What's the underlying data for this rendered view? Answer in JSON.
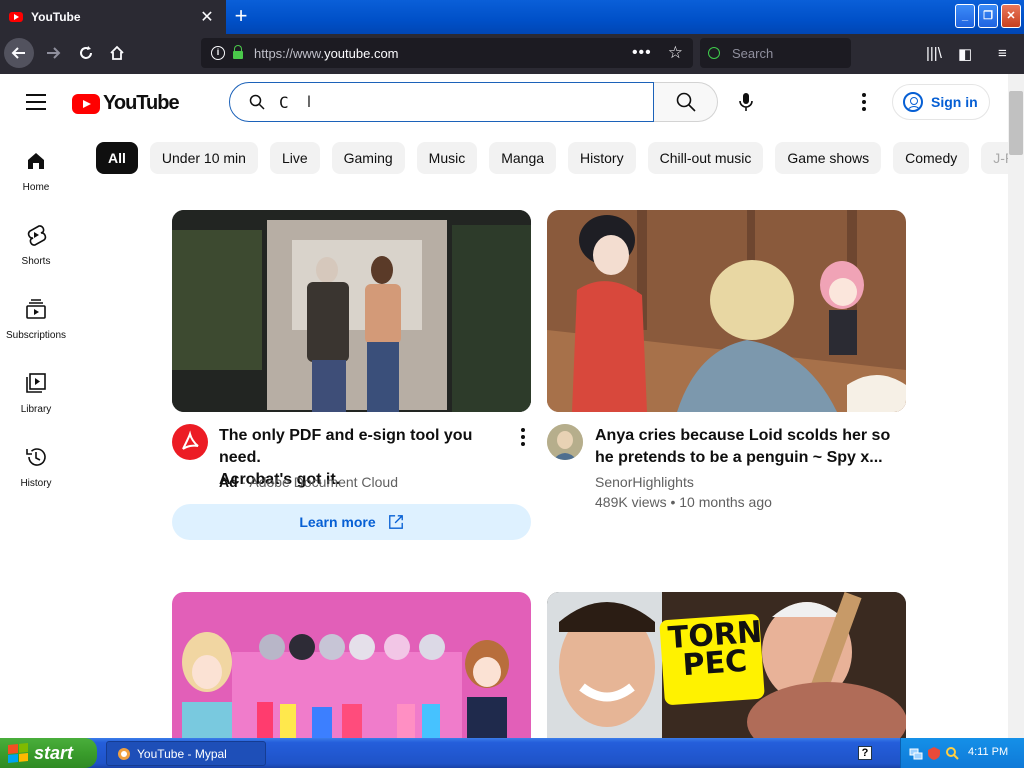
{
  "browser": {
    "tab_title": "YouTube",
    "tab_close": "✕",
    "new_tab": "+",
    "url_prefix": "https://www.",
    "url_domain": "youtube.com",
    "search_placeholder": "Search",
    "window_buttons": {
      "minimize": "_",
      "restore": "❐",
      "close": "✕"
    }
  },
  "youtube": {
    "logo_text": "YouTube",
    "search_value": "C",
    "sign_in_label": "Sign in",
    "chips": [
      "All",
      "Under 10 min",
      "Live",
      "Gaming",
      "Music",
      "Manga",
      "History",
      "Chill-out music",
      "Game shows",
      "Comedy",
      "J-Pop"
    ],
    "nav": [
      {
        "label": "Home",
        "icon": "home-icon"
      },
      {
        "label": "Shorts",
        "icon": "shorts-icon"
      },
      {
        "label": "Subscriptions",
        "icon": "subscriptions-icon"
      },
      {
        "label": "Library",
        "icon": "library-icon"
      },
      {
        "label": "History",
        "icon": "history-icon"
      }
    ],
    "videos": [
      {
        "title_line1": "The only PDF and e-sign tool you need.",
        "title_line2": "Acrobat's got it.",
        "ad_badge": "Ad",
        "separator": "·",
        "channel": "Adobe Document Cloud",
        "cta": "Learn more"
      },
      {
        "title_line1": "Anya cries because Loid scolds her so",
        "title_line2": "he pretends to be a penguin ~ Spy x...",
        "channel": "SenorHighlights",
        "views_and_age": "489K views • 10 months ago"
      },
      {
        "thumb_text": ""
      },
      {
        "thumb_text_line1": "TORN",
        "thumb_text_line2": "PEC"
      }
    ]
  },
  "taskbar": {
    "start_label": "start",
    "task_label": "YouTube - Mypal",
    "help": "?",
    "clock": "4:11 PM"
  },
  "colors": {
    "yt_red": "#ff0000",
    "link_blue": "#065fd4",
    "xp_blue": "#245edb",
    "xp_green": "#3a9d2c"
  }
}
